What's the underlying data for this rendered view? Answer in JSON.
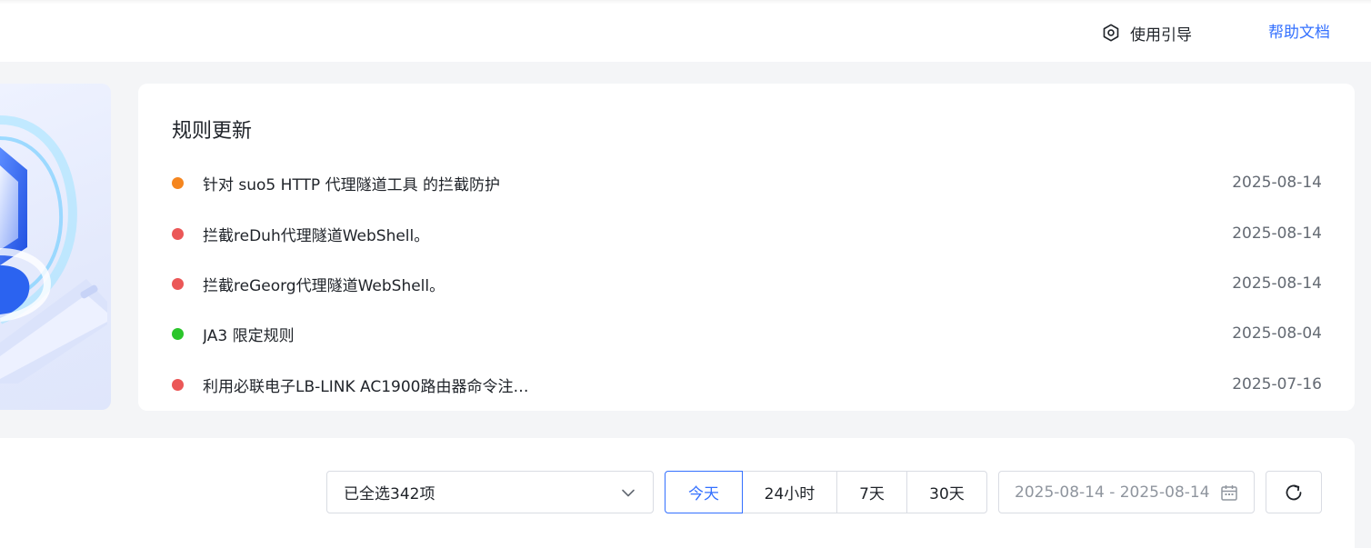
{
  "header": {
    "guide_label": "使用引导",
    "help_label": "帮助文档"
  },
  "rules_panel": {
    "title": "规则更新",
    "items": [
      {
        "text": "针对 suo5 HTTP 代理隧道工具 的拦截防护",
        "date": "2025-08-14",
        "dot_color": "#f5861f"
      },
      {
        "text": "拦截reDuh代理隧道WebShell。",
        "date": "2025-08-14",
        "dot_color": "#eb5757"
      },
      {
        "text": "拦截reGeorg代理隧道WebShell。",
        "date": "2025-08-14",
        "dot_color": "#eb5757"
      },
      {
        "text": "JA3 限定规则",
        "date": "2025-08-04",
        "dot_color": "#2bc52b"
      },
      {
        "text": "利用必联电子LB-LINK AC1900路由器命令注…",
        "date": "2025-07-16",
        "dot_color": "#eb5757"
      }
    ]
  },
  "filters": {
    "select_value": "已全选342项",
    "time_tabs": [
      {
        "label": "今天",
        "active": true
      },
      {
        "label": "24小时",
        "active": false
      },
      {
        "label": "7天",
        "active": false
      },
      {
        "label": "30天",
        "active": false
      }
    ],
    "date_range": "2025-08-14 - 2025-08-14"
  },
  "colors": {
    "accent": "#3370ff",
    "page_bg": "#f4f5f7"
  },
  "icons": {
    "guide": "guide-icon",
    "select_chevron": "chevron-down-icon",
    "calendar": "calendar-icon",
    "refresh": "refresh-icon"
  }
}
